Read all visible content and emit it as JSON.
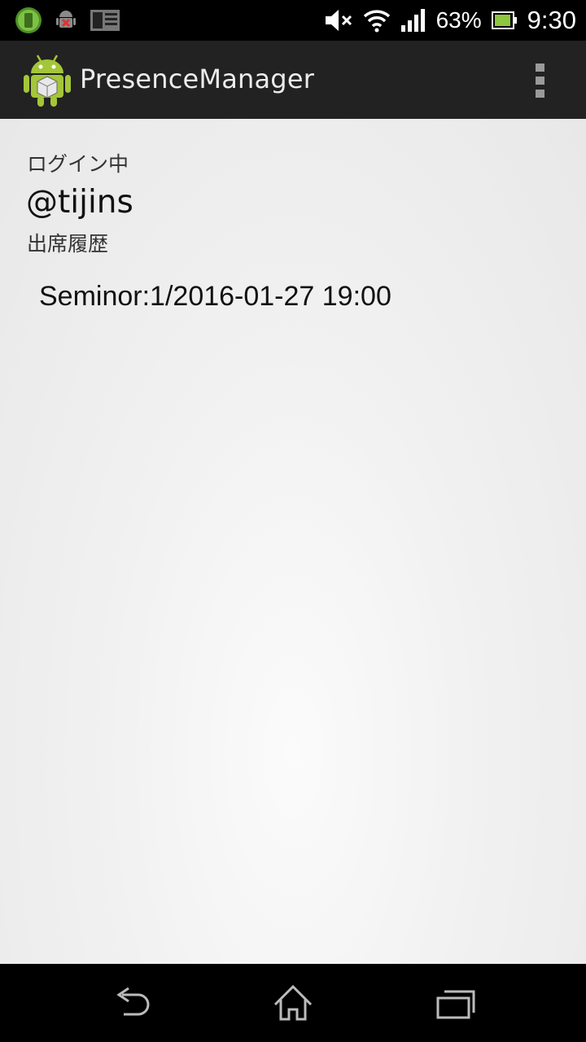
{
  "status_bar": {
    "notification_icons": [
      "battery-app-icon",
      "android-debug-icon",
      "news-app-icon"
    ],
    "icons": [
      "mute-icon",
      "wifi-icon",
      "signal-icon"
    ],
    "battery_percent": "63%",
    "time": "9:30"
  },
  "action_bar": {
    "title": "PresenceManager",
    "icon": "android-app-icon",
    "menu_icon": "overflow-menu-icon"
  },
  "main": {
    "login_label": "ログイン中",
    "username": "@tijins",
    "history_label": "出席履歴",
    "history": [
      "Seminor:1/2016-01-27 19:00"
    ]
  },
  "nav_bar": {
    "buttons": [
      "back-icon",
      "home-icon",
      "recents-icon"
    ]
  },
  "colors": {
    "action_bar": "#222222",
    "content_bg": "#eeeeee",
    "android_green": "#a4c639"
  }
}
